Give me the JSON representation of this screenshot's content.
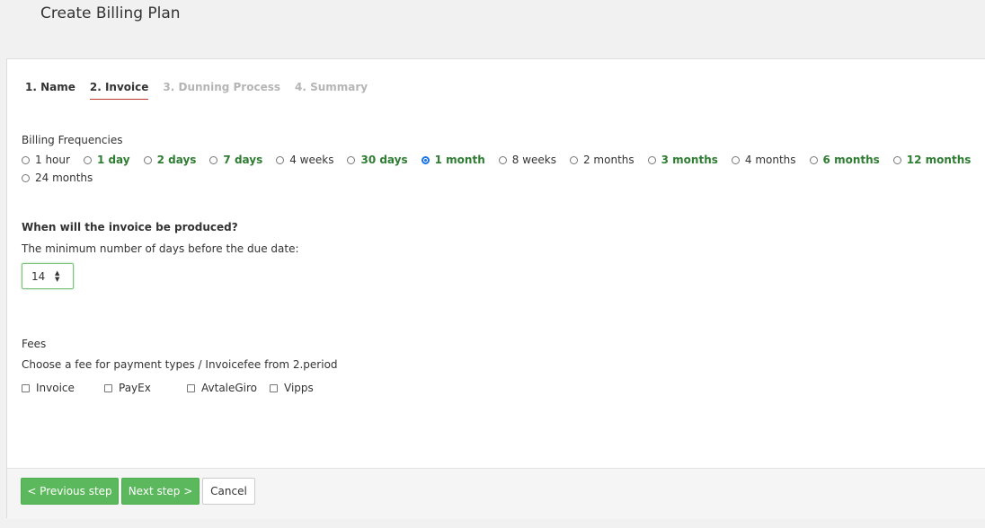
{
  "page": {
    "title": "Create Billing Plan"
  },
  "tabs": [
    {
      "label": "1. Name",
      "state": "normal"
    },
    {
      "label": "2. Invoice",
      "state": "active"
    },
    {
      "label": "3. Dunning Process",
      "state": "disabled"
    },
    {
      "label": "4. Summary",
      "state": "disabled"
    }
  ],
  "billing": {
    "label": "Billing Frequencies",
    "options": [
      {
        "label": "1 hour",
        "bold": false,
        "checked": false
      },
      {
        "label": "1 day",
        "bold": true,
        "checked": false
      },
      {
        "label": "2 days",
        "bold": true,
        "checked": false
      },
      {
        "label": "7 days",
        "bold": true,
        "checked": false
      },
      {
        "label": "4 weeks",
        "bold": false,
        "checked": false
      },
      {
        "label": "30 days",
        "bold": true,
        "checked": false
      },
      {
        "label": "1 month",
        "bold": true,
        "checked": true
      },
      {
        "label": "8 weeks",
        "bold": false,
        "checked": false
      },
      {
        "label": "2 months",
        "bold": false,
        "checked": false
      },
      {
        "label": "3 months",
        "bold": true,
        "checked": false
      },
      {
        "label": "4 months",
        "bold": false,
        "checked": false
      },
      {
        "label": "6 months",
        "bold": true,
        "checked": false
      },
      {
        "label": "12 months",
        "bold": true,
        "checked": false
      },
      {
        "label": "24 months",
        "bold": false,
        "checked": false
      }
    ]
  },
  "invoice": {
    "question": "When will the invoice be produced?",
    "min_days_label": "The minimum number of days before the due date:",
    "min_days_value": "14"
  },
  "fees": {
    "label": "Fees",
    "description": "Choose a fee for payment types / Invoicefee from 2.period",
    "options": [
      "Invoice",
      "PayEx",
      "AvtaleGiro",
      "Vipps"
    ]
  },
  "footer": {
    "previous_label": "< Previous step",
    "next_label": "Next step >",
    "cancel_label": "Cancel"
  },
  "colors": {
    "accent_green": "#5cb85c",
    "bold_option_green": "#2e7d32",
    "radio_selected_blue": "#1a73e8",
    "active_tab_underline": "#c0392b"
  }
}
